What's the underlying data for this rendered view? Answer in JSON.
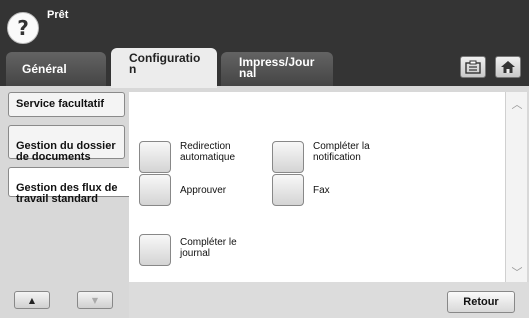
{
  "header": {
    "status": "Prêt",
    "help_icon": "help-icon"
  },
  "tabs": [
    {
      "label": "Général",
      "active": false
    },
    {
      "label": "Configuratio\nn",
      "active": true
    },
    {
      "label": "Impress/Jour\nnal",
      "active": false
    }
  ],
  "toolbar_icons": [
    "clipboard-icon",
    "home-icon"
  ],
  "sidebar": {
    "items": [
      {
        "label": "Service facultatif",
        "active": false
      },
      {
        "label": "Gestion du dossier\nde documents",
        "active": false
      },
      {
        "label": "Gestion des flux de\ntravail standard",
        "active": true
      }
    ]
  },
  "options": [
    {
      "label": "Redirection\nautomatique"
    },
    {
      "label": "Compléter la\nnotification"
    },
    {
      "label": "Approuver"
    },
    {
      "label": "Fax"
    },
    {
      "label": "Compléter le\njournal"
    }
  ],
  "footer": {
    "retour_label": "Retour",
    "up_arrow": "▲",
    "down_arrow": "▼"
  },
  "scrollbar": {
    "up": "︿",
    "down": "﹀"
  },
  "colors": {
    "header_bg": "#343434",
    "panel_bg": "#d8d8d8",
    "content_bg": "#ffffff"
  }
}
